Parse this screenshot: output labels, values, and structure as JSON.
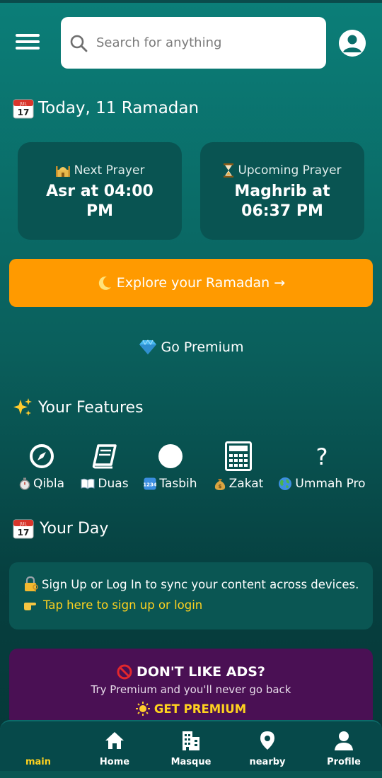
{
  "header": {
    "search_placeholder": "Search for anything"
  },
  "today": {
    "label": "Today, 11 Ramadan",
    "calendar_day": "17",
    "calendar_month": "JUL"
  },
  "prayers": {
    "next": {
      "label": "Next Prayer",
      "value": "Asr at 04:00 PM"
    },
    "upcoming": {
      "label": "Upcoming Prayer",
      "value": "Maghrib at 06:37 PM"
    }
  },
  "explore": {
    "label": "Explore your Ramadan →"
  },
  "premium": {
    "label": "Go Premium"
  },
  "features": {
    "title": "Your Features",
    "items": [
      {
        "label": "Qibla",
        "icon": "compass-icon"
      },
      {
        "label": "Duas",
        "icon": "book-icon"
      },
      {
        "label": "Tasbih",
        "icon": "circle-icon"
      },
      {
        "label": "Zakat",
        "icon": "calculator-icon"
      },
      {
        "label": "Ummah Pro",
        "icon": "question-icon"
      }
    ]
  },
  "your_day": {
    "title": "Your Day"
  },
  "signup": {
    "text": "Sign Up or Log In to sync your content across devices.",
    "link": "Tap here to sign up or login"
  },
  "ads": {
    "title": "DON'T LIKE ADS?",
    "subtitle": "Try Premium and you'll never go back",
    "cta": "GET PREMIUM"
  },
  "nav": {
    "items": [
      {
        "label": "main",
        "active": true
      },
      {
        "label": "Home"
      },
      {
        "label": "Masque"
      },
      {
        "label": "nearby"
      },
      {
        "label": "Profile"
      }
    ]
  },
  "colors": {
    "accent_orange": "#ff9a00",
    "accent_yellow": "#ffd21f",
    "ads_purple": "#4a1054",
    "card_teal": "#095452"
  }
}
